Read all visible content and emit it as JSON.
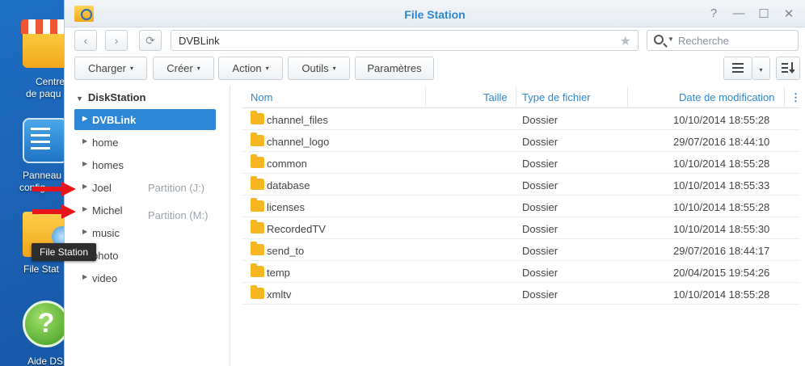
{
  "desktop": {
    "icons": [
      {
        "label1": "Centre",
        "label2": "de paqu"
      },
      {
        "label1": "Panneau",
        "label2": "config"
      },
      {
        "label1": "File Stat"
      },
      {
        "label1": "Aide DS"
      }
    ],
    "help_glyph": "?",
    "tooltip": "File Station"
  },
  "window": {
    "title": "File Station",
    "controls": [
      "?",
      "—",
      "☐",
      "✕"
    ]
  },
  "nav": {
    "back": "‹",
    "forward": "›",
    "refresh": "⟳",
    "path": "DVBLink",
    "search_placeholder": "Recherche"
  },
  "toolbar": {
    "charger": "Charger",
    "creer": "Créer",
    "action": "Action",
    "outils": "Outils",
    "parametres": "Paramètres",
    "caret": "▾"
  },
  "tree": {
    "root": "DiskStation",
    "items": [
      "DVBLink",
      "home",
      "homes",
      "Joel",
      "Michel",
      "music",
      "photo",
      "video"
    ],
    "partitions": [
      "Partition (J:)",
      "Partition (M:)"
    ]
  },
  "table": {
    "headers": {
      "name": "Nom",
      "size": "Taille",
      "type": "Type de fichier",
      "date": "Date de modification"
    },
    "rows": [
      {
        "name": "channel_files",
        "type": "Dossier",
        "date": "10/10/2014 18:55:28"
      },
      {
        "name": "channel_logo",
        "type": "Dossier",
        "date": "29/07/2016 18:44:10"
      },
      {
        "name": "common",
        "type": "Dossier",
        "date": "10/10/2014 18:55:28"
      },
      {
        "name": "database",
        "type": "Dossier",
        "date": "10/10/2014 18:55:33"
      },
      {
        "name": "licenses",
        "type": "Dossier",
        "date": "10/10/2014 18:55:28"
      },
      {
        "name": "RecordedTV",
        "type": "Dossier",
        "date": "10/10/2014 18:55:30"
      },
      {
        "name": "send_to",
        "type": "Dossier",
        "date": "29/07/2016 18:44:17"
      },
      {
        "name": "temp",
        "type": "Dossier",
        "date": "20/04/2015 19:54:26"
      },
      {
        "name": "xmltv",
        "type": "Dossier",
        "date": "10/10/2014 18:55:28"
      }
    ]
  },
  "colors": {
    "accent": "#2f86d0",
    "selected": "#2e86d6",
    "folder": "#f5b621",
    "arrow": "#e8141c"
  }
}
